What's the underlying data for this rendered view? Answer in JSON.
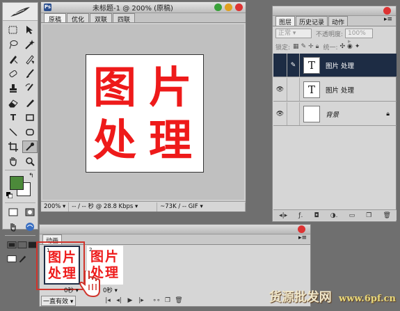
{
  "document": {
    "title": "未标题-1 @ 200% (原稿)",
    "tabs": [
      "原稿",
      "优化",
      "双联",
      "四联"
    ],
    "active_tab": "原稿",
    "canvas_text": [
      "图",
      "片",
      "处",
      "理"
    ],
    "status": {
      "zoom": "200%",
      "timing": "-- / -- 秒 @ 28.8 Kbps",
      "size": "~73K / -- GIF"
    }
  },
  "layers_panel": {
    "tabs": [
      "图层",
      "历史记录",
      "动作"
    ],
    "active_tab": "图层",
    "blend_mode": "正常",
    "opacity_label": "不透明度:",
    "opacity_value": "100%",
    "lock_label": "锁定:",
    "unify_label": "统一:",
    "layers": [
      {
        "name": "图片 处理",
        "thumb": "T",
        "visible": false,
        "selected": true
      },
      {
        "name": "图片 处理",
        "thumb": "T",
        "visible": true,
        "selected": false
      },
      {
        "name": "背景",
        "thumb": "",
        "visible": true,
        "selected": false
      }
    ]
  },
  "animation_panel": {
    "title": "动画",
    "frames": [
      {
        "number": "1",
        "text": [
          "图",
          "片",
          "处",
          "理"
        ],
        "delay": "0秒"
      },
      {
        "number": "2",
        "text": [
          "图",
          "片",
          "处",
          "理"
        ],
        "delay": "0秒"
      }
    ],
    "loop": "一直有效"
  },
  "watermark": {
    "text": "货源批发网",
    "url": "www.6pf.cn"
  },
  "colors": {
    "foreground": "#4c8a3a",
    "background": "#ffffff",
    "text_red": "#ee1a1a",
    "selection": "#1d2c44",
    "highlight": "#d0342c"
  }
}
